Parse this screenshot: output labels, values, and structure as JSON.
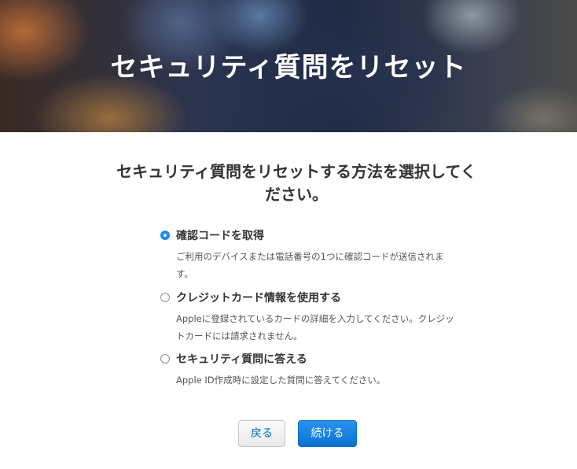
{
  "hero": {
    "title": "セキュリティ質問をリセット"
  },
  "main": {
    "prompt": "セキュリティ質問をリセットする方法を選択してください。",
    "options": [
      {
        "label": "確認コードを取得",
        "description": "ご利用のデバイスまたは電話番号の1つに確認コードが送信されます。",
        "selected": true
      },
      {
        "label": "クレジットカード情報を使用する",
        "description": "Appleに登録されているカードの詳細を入力してください。クレジットカードには請求されません。",
        "selected": false
      },
      {
        "label": "セキュリティ質問に答える",
        "description": "Apple ID作成時に設定した質問に答えてください。",
        "selected": false
      }
    ]
  },
  "buttons": {
    "back_label": "戻る",
    "continue_label": "続ける"
  },
  "colors": {
    "accent": "#1e88f0",
    "link": "#0070c9"
  }
}
